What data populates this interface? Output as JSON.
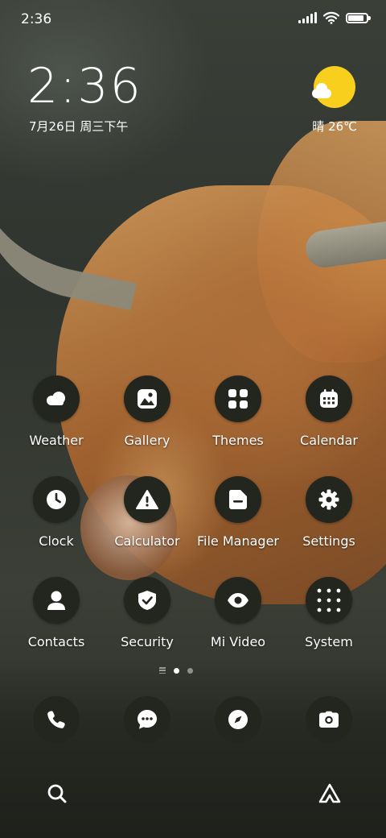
{
  "status_bar": {
    "time": "2:36",
    "battery_level": 0.85
  },
  "clock_widget": {
    "time": "2:36",
    "date": "7月26日 周三下午"
  },
  "weather_widget": {
    "condition_temp": "晴 26℃"
  },
  "apps": [
    {
      "label": "Weather",
      "icon": "weather-icon"
    },
    {
      "label": "Gallery",
      "icon": "gallery-icon"
    },
    {
      "label": "Themes",
      "icon": "themes-icon"
    },
    {
      "label": "Calendar",
      "icon": "calendar-icon"
    },
    {
      "label": "Clock",
      "icon": "clock-icon"
    },
    {
      "label": "Calculator",
      "icon": "calculator-icon"
    },
    {
      "label": "File Manager",
      "icon": "file-manager-icon"
    },
    {
      "label": "Settings",
      "icon": "gear-icon"
    },
    {
      "label": "Contacts",
      "icon": "contacts-icon"
    },
    {
      "label": "Security",
      "icon": "shield-icon"
    },
    {
      "label": "Mi Video",
      "icon": "eye-icon"
    },
    {
      "label": "System",
      "icon": "folder-grid-icon"
    }
  ],
  "page_indicator": {
    "current_page": 1,
    "total_pages": 2
  },
  "dock": [
    {
      "icon": "phone-icon"
    },
    {
      "icon": "message-icon"
    },
    {
      "icon": "compass-icon"
    },
    {
      "icon": "camera-icon"
    }
  ],
  "bottom_bar": {
    "left_icon": "search-icon",
    "right_icon": "app-vault-icon"
  },
  "colors": {
    "icon_bg": "#23261f",
    "sun": "#f7cf1c"
  }
}
